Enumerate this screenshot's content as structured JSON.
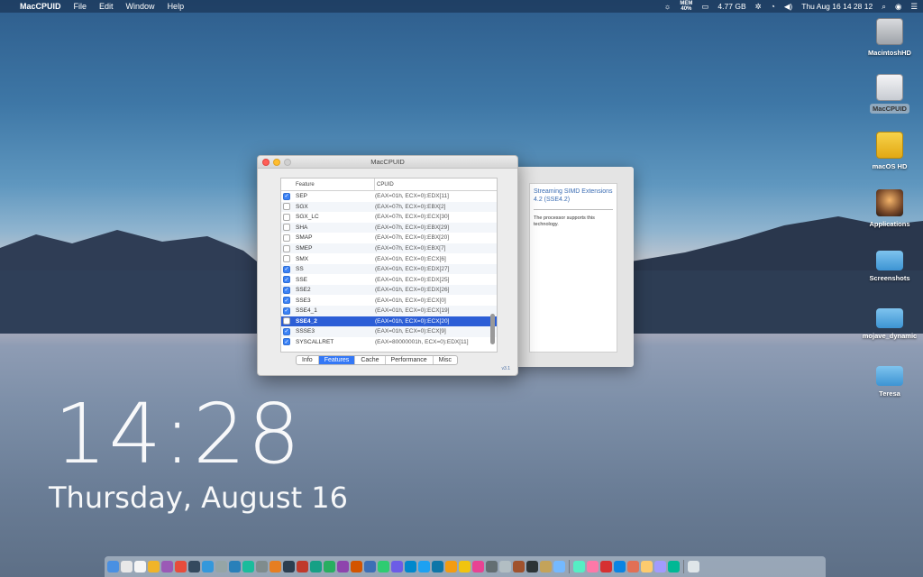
{
  "menubar": {
    "app_name": "MacCPUID",
    "menus": [
      "File",
      "Edit",
      "Window",
      "Help"
    ],
    "memory_badge": "MEM\n40%",
    "storage": "4.77 GB",
    "datetime": "Thu Aug 16  14 28 12"
  },
  "desktop_icons": [
    {
      "label": "MacintoshHD"
    },
    {
      "label": "MacCPUID"
    },
    {
      "label": "macOS HD"
    },
    {
      "label": "Applications"
    },
    {
      "label": "Screenshots"
    },
    {
      "label": "mojave_dynamic"
    },
    {
      "label": "Teresa"
    }
  ],
  "window": {
    "title": "MacCPUID",
    "columns": [
      "Feature",
      "CPUID"
    ],
    "rows": [
      {
        "name": "SEP",
        "cpuid": "(EAX=01h, ECX=0):EDX[11]",
        "checked": true
      },
      {
        "name": "SGX",
        "cpuid": "(EAX=07h, ECX=0):EBX[2]",
        "checked": false
      },
      {
        "name": "SGX_LC",
        "cpuid": "(EAX=07h, ECX=0):ECX[30]",
        "checked": false
      },
      {
        "name": "SHA",
        "cpuid": "(EAX=07h, ECX=0):EBX[29]",
        "checked": false
      },
      {
        "name": "SMAP",
        "cpuid": "(EAX=07h, ECX=0):EBX[20]",
        "checked": false
      },
      {
        "name": "SMEP",
        "cpuid": "(EAX=07h, ECX=0):EBX[7]",
        "checked": false
      },
      {
        "name": "SMX",
        "cpuid": "(EAX=01h, ECX=0):ECX[6]",
        "checked": false
      },
      {
        "name": "SS",
        "cpuid": "(EAX=01h, ECX=0):EDX[27]",
        "checked": true
      },
      {
        "name": "SSE",
        "cpuid": "(EAX=01h, ECX=0):EDX[25]",
        "checked": true
      },
      {
        "name": "SSE2",
        "cpuid": "(EAX=01h, ECX=0):EDX[26]",
        "checked": true
      },
      {
        "name": "SSE3",
        "cpuid": "(EAX=01h, ECX=0):ECX[0]",
        "checked": true
      },
      {
        "name": "SSE4_1",
        "cpuid": "(EAX=01h, ECX=0):ECX[19]",
        "checked": true
      },
      {
        "name": "SSE4_2",
        "cpuid": "(EAX=01h, ECX=0):ECX[20]",
        "checked": false,
        "selected": true
      },
      {
        "name": "SSSE3",
        "cpuid": "(EAX=01h, ECX=0):ECX[9]",
        "checked": true
      },
      {
        "name": "SYSCALLRET",
        "cpuid": "(EAX=80000001h, ECX=0):EDX[11]",
        "checked": true
      }
    ],
    "tabs": [
      "Info",
      "Features",
      "Cache",
      "Performance",
      "Misc"
    ],
    "active_tab": "Features",
    "version": "v3.1"
  },
  "detail": {
    "title": "Streaming SIMD Extensions 4.2 (SSE4.2)",
    "description": "The processor supports this technology."
  },
  "clock": {
    "time": "14:28",
    "date": "Thursday, August 16"
  }
}
